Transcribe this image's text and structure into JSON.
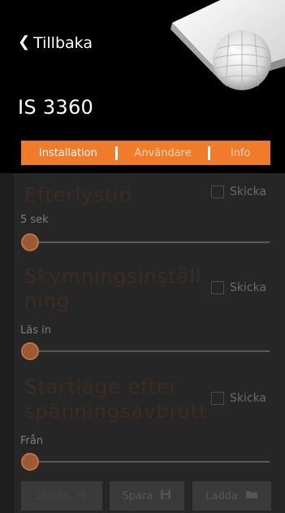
{
  "header": {
    "back_label": "Tillbaka",
    "title": "IS 3360"
  },
  "tabs": [
    {
      "label": "Installation",
      "active": true
    },
    {
      "label": "Användare",
      "active": false
    },
    {
      "label": "Info",
      "active": false
    }
  ],
  "sections": [
    {
      "title": "Efterlystid",
      "checkbox_label": "Skicka",
      "value_label": "5 sek",
      "slider_value": 0
    },
    {
      "title": "Skymningsinställ\nning",
      "checkbox_label": "Skicka",
      "value_label": "Läs in",
      "slider_value": 0
    },
    {
      "title": "Startläge efter\nspänningsavbrott",
      "checkbox_label": "Skicka",
      "value_label": "Från",
      "slider_value": 0
    }
  ],
  "actions": {
    "send_label": "Skicka",
    "save_label": "Spara",
    "load_label": "Ladda"
  },
  "colors": {
    "accent": "#f07b2a",
    "header_bg": "#000000",
    "content_bg": "#262626",
    "thumb": "#9a5a34"
  },
  "icons": [
    "chevron-left-icon",
    "wifi-signal-icon",
    "floppy-disk-icon",
    "folder-icon"
  ]
}
